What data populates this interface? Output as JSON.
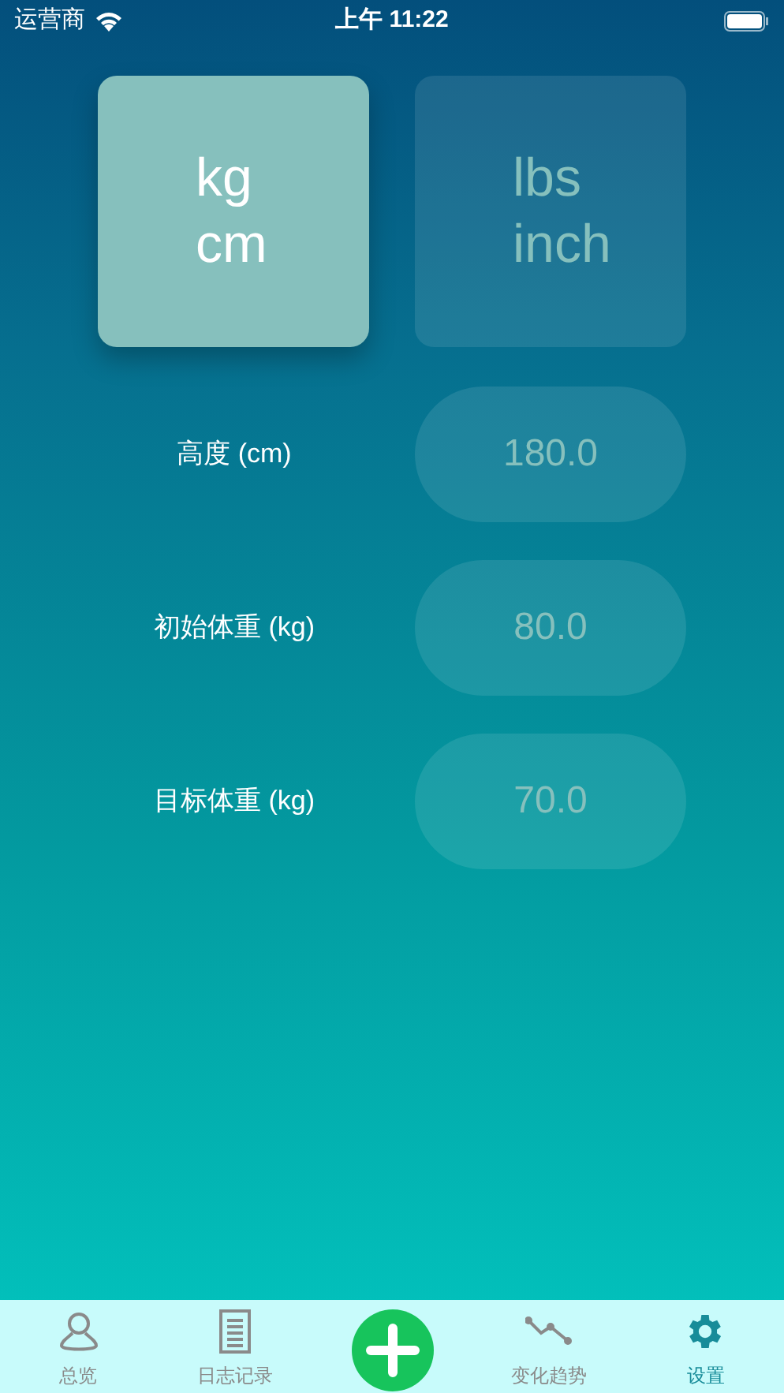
{
  "status_bar": {
    "carrier": "运营商",
    "time": "上午 11:22"
  },
  "unit_options": [
    {
      "lines": [
        "kg",
        "cm"
      ],
      "selected": true
    },
    {
      "lines": [
        "lbs",
        "inch"
      ],
      "selected": false
    }
  ],
  "fields": [
    {
      "label": "高度 (cm)",
      "value": "180.0"
    },
    {
      "label": "初始体重 (kg)",
      "value": "80.0"
    },
    {
      "label": "目标体重 (kg)",
      "value": "70.0"
    }
  ],
  "tab_bar": [
    {
      "kind": "overview",
      "label": "总览",
      "selected": false
    },
    {
      "kind": "log",
      "label": "日志记录",
      "selected": false
    },
    {
      "kind": "add"
    },
    {
      "kind": "trend",
      "label": "变化趋势",
      "selected": false
    },
    {
      "kind": "settings",
      "label": "设置",
      "selected": true
    }
  ]
}
